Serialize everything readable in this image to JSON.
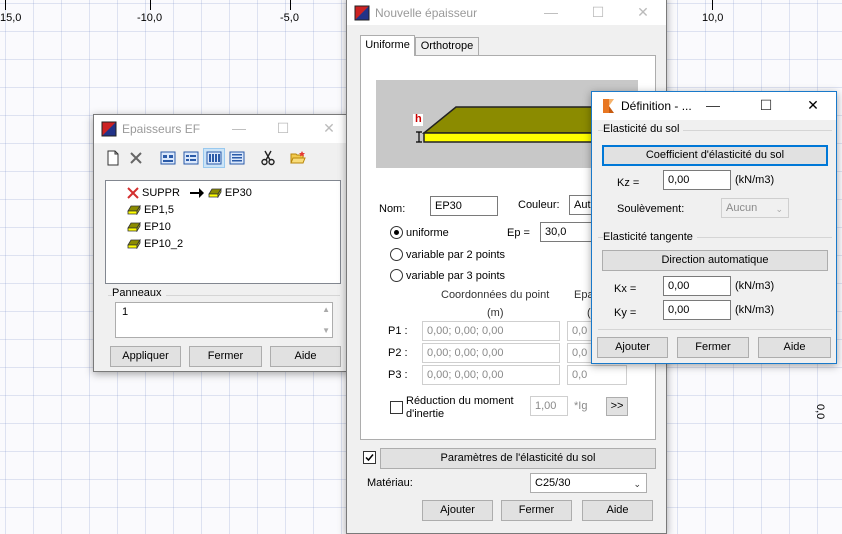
{
  "ruler": {
    "ticks": [
      "15,0",
      "-10,0",
      "-5,0",
      "10,0"
    ],
    "side_label": "0,0"
  },
  "epaisseurs_window": {
    "title": "Epaisseurs EF",
    "tree": {
      "suppr": "SUPPR",
      "arrow_target": "EP30",
      "items": [
        "EP1,5",
        "EP10",
        "EP10_2"
      ]
    },
    "panneaux_label": "Panneaux",
    "panneaux_value": "1",
    "buttons": {
      "apply": "Appliquer",
      "close": "Fermer",
      "help": "Aide"
    }
  },
  "nouvelle_window": {
    "title": "Nouvelle épaisseur",
    "tabs": [
      "Uniforme",
      "Orthotrope"
    ],
    "preview_h_label": "h",
    "nom_label": "Nom:",
    "nom_value": "EP30",
    "couleur_label": "Couleur:",
    "couleur_value": "Auto",
    "radio_uniforme": "uniforme",
    "radio_var2": "variable par 2 points",
    "radio_var3": "variable par 3 points",
    "ep_label": "Ep =",
    "ep_value": "30,0",
    "coords_header": "Coordonnées du point",
    "coords_unit": "(m)",
    "epaisseur_header": "Epa",
    "epaisseur_unit": "(c",
    "points": [
      {
        "label": "P1 :",
        "coords": "0,00; 0,00; 0,00",
        "ep": "0,0"
      },
      {
        "label": "P2 :",
        "coords": "0,00; 0,00; 0,00",
        "ep": "0,0"
      },
      {
        "label": "P3 :",
        "coords": "0,00; 0,00; 0,00",
        "ep": "0,0"
      }
    ],
    "reduction_label_1": "Réduction du moment",
    "reduction_label_2": "d'inertie",
    "reduction_value": "1,00",
    "reduction_unit": "*Ig",
    "more_button": ">>",
    "elasticite_button": "Paramètres de l'élasticité du sol",
    "materiau_label": "Matériau:",
    "materiau_value": "C25/30",
    "buttons": {
      "add": "Ajouter",
      "close": "Fermer",
      "help": "Aide"
    }
  },
  "definition_window": {
    "title": "Définition - ...",
    "group1": "Elasticité du sol",
    "coef_button": "Coefficient d'élasticité du sol",
    "kz_label": "Kz =",
    "kz_value": "0,00",
    "kz_unit": "(kN/m3)",
    "soulevement_label": "Soulèvement:",
    "soulevement_value": "Aucun",
    "group2": "Elasticité tangente",
    "direction_button": "Direction automatique",
    "kx_label": "Kx =",
    "kx_value": "0,00",
    "kx_unit": "(kN/m3)",
    "ky_label": "Ky =",
    "ky_value": "0,00",
    "ky_unit": "(kN/m3)",
    "buttons": {
      "add": "Ajouter",
      "close": "Fermer",
      "help": "Aide"
    }
  },
  "colors": {
    "plate_top": "#8b8b00",
    "plate_side": "#ffff00",
    "preview_bg": "#c8c8c8",
    "accent": "#0078d7"
  }
}
